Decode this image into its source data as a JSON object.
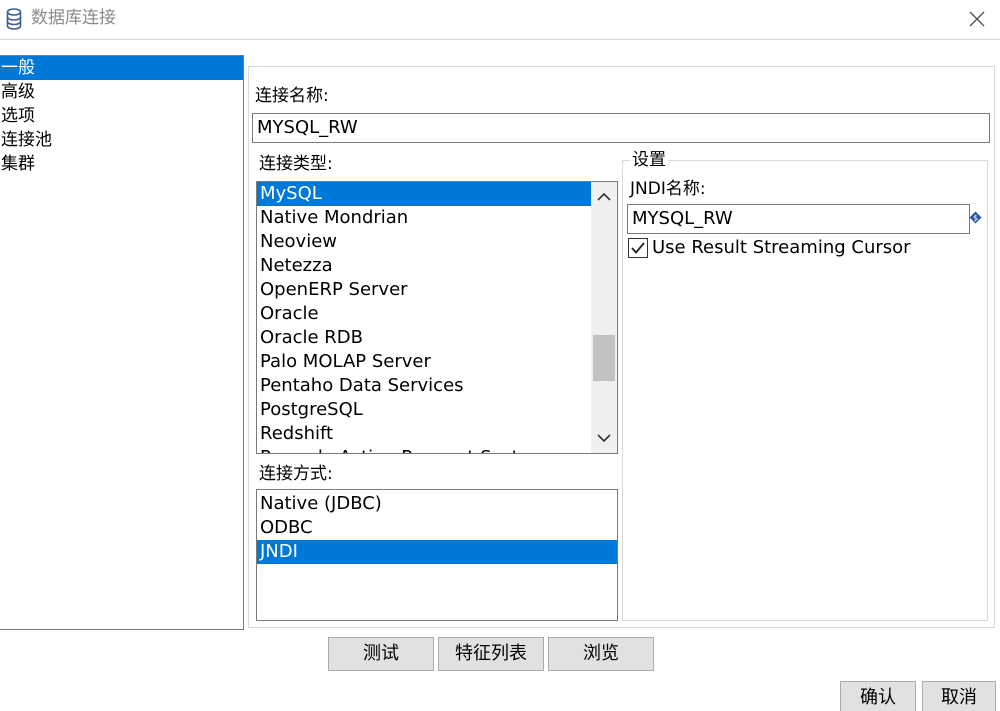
{
  "window": {
    "title": "数据库连接",
    "icon": "database-icon",
    "close_icon": "close-icon"
  },
  "nav": {
    "items": [
      {
        "label": "一般",
        "selected": true
      },
      {
        "label": "高级",
        "selected": false
      },
      {
        "label": "选项",
        "selected": false
      },
      {
        "label": "连接池",
        "selected": false
      },
      {
        "label": "集群",
        "selected": false
      }
    ]
  },
  "connection_name": {
    "label": "连接名称:",
    "value": "MYSQL_RW"
  },
  "connection_type": {
    "label": "连接类型:",
    "items": [
      {
        "label": "MySQL",
        "selected": true
      },
      {
        "label": "Native Mondrian",
        "selected": false
      },
      {
        "label": "Neoview",
        "selected": false
      },
      {
        "label": "Netezza",
        "selected": false
      },
      {
        "label": "OpenERP Server",
        "selected": false
      },
      {
        "label": "Oracle",
        "selected": false
      },
      {
        "label": "Oracle RDB",
        "selected": false
      },
      {
        "label": "Palo MOLAP Server",
        "selected": false
      },
      {
        "label": "Pentaho Data Services",
        "selected": false
      },
      {
        "label": "PostgreSQL",
        "selected": false
      },
      {
        "label": "Redshift",
        "selected": false
      },
      {
        "label": "Remedy Action Request System",
        "selected": false
      }
    ]
  },
  "access_method": {
    "label": "连接方式:",
    "items": [
      {
        "label": "Native (JDBC)",
        "selected": false
      },
      {
        "label": "ODBC",
        "selected": false
      },
      {
        "label": "JNDI",
        "selected": true
      }
    ]
  },
  "settings": {
    "legend": "设置",
    "jndi_label": "JNDI名称:",
    "jndi_value": "MYSQL_RW",
    "variable_icon": "variable-diamond-icon",
    "streaming_label": "Use Result Streaming Cursor",
    "streaming_checked": true
  },
  "buttons": {
    "test": "测试",
    "features": "特征列表",
    "explore": "浏览",
    "ok": "确认",
    "cancel": "取消"
  },
  "colors": {
    "selection": "#0078d7",
    "variable_icon": "#2c5aa0"
  }
}
